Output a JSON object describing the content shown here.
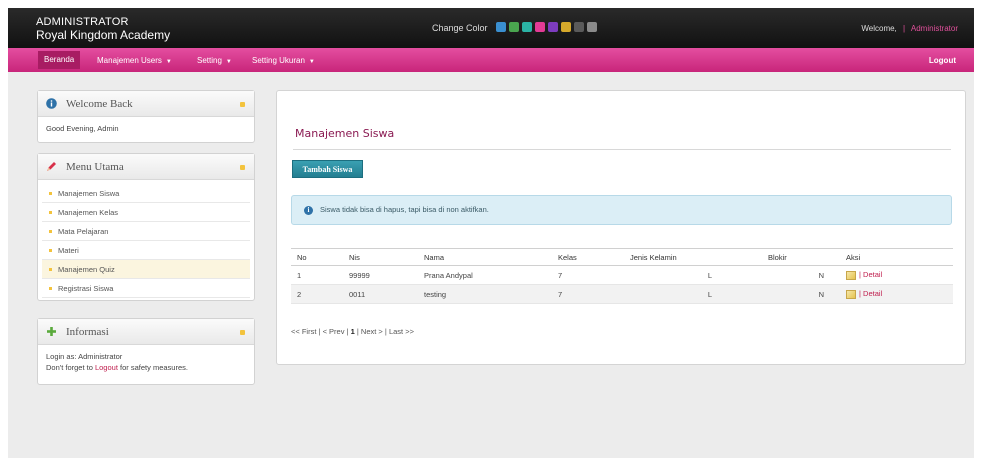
{
  "header": {
    "title_line1": "ADMINISTRATOR",
    "title_line2": "Royal Kingdom Academy",
    "change_color_label": "Change Color",
    "swatches": [
      "#3a8fd0",
      "#4aa54f",
      "#2bb3a5",
      "#e33b95",
      "#7d3cbf",
      "#d6a92b",
      "#5a5a5a",
      "#8a8a8a"
    ],
    "welcome_label": "Welcome,",
    "separator": "|",
    "user": "Administrator"
  },
  "nav": {
    "items": [
      {
        "label": "Beranda"
      },
      {
        "label": "Manajemen Users"
      },
      {
        "label": "Setting"
      },
      {
        "label": "Setting Ukuran"
      }
    ],
    "logout": "Logout"
  },
  "welcome_panel": {
    "title": "Welcome Back",
    "greeting": "Good Evening, Admin"
  },
  "menu_panel": {
    "title": "Menu Utama",
    "items": [
      "Manajemen Siswa",
      "Manajemen Kelas",
      "Mata Pelajaran",
      "Materi",
      "Manajemen Quiz",
      "Registrasi Siswa"
    ]
  },
  "info_panel": {
    "title": "Informasi",
    "login_prefix": "Login as:",
    "login_user": "Administrator",
    "forget_prefix": "Don't forget to",
    "logout_link": "Logout",
    "forget_suffix": "for safety measures."
  },
  "main": {
    "title": "Manajemen Siswa",
    "add_button": "Tambah Siswa",
    "notice": "Siswa tidak bisa di hapus, tapi bisa di non aktifkan.",
    "columns": [
      "No",
      "Nis",
      "Nama",
      "Kelas",
      "Jenis Kelamin",
      "Blokir",
      "Aksi"
    ],
    "rows": [
      {
        "no": "1",
        "nis": "99999",
        "nama": "Prana Andypal",
        "kelas": "7",
        "jk": "L",
        "blokir": "N",
        "detail": "| Detail"
      },
      {
        "no": "2",
        "nis": "0011",
        "nama": "testing",
        "kelas": "7",
        "jk": "L",
        "blokir": "N",
        "detail": "| Detail"
      }
    ],
    "pager": {
      "first": "<< First",
      "prev": "< Prev",
      "current": "1",
      "next": "Next >",
      "last": "Last >>",
      "sep": "|"
    }
  }
}
